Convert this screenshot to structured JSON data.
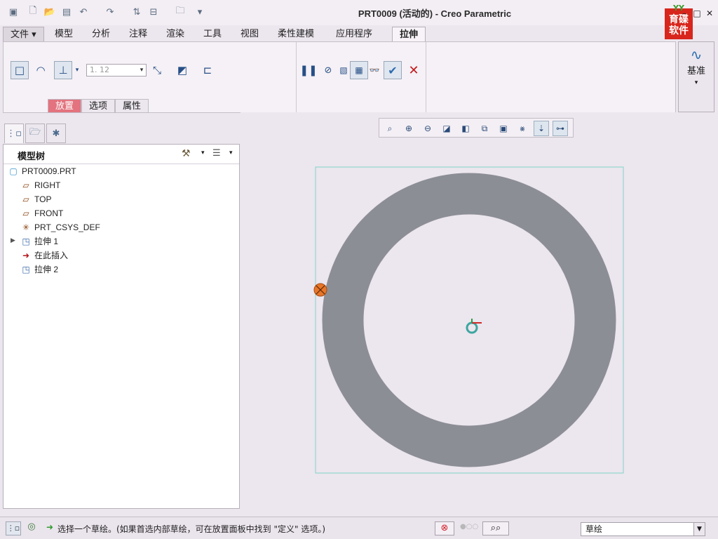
{
  "window": {
    "title": "PRT0009 (活动的) - Creo Parametric",
    "logo_text": "育碟软件",
    "logo_top": "YY"
  },
  "tabs": [
    {
      "label": "文件 ▾"
    },
    {
      "label": "模型"
    },
    {
      "label": "分析"
    },
    {
      "label": "注释"
    },
    {
      "label": "渲染"
    },
    {
      "label": "工具"
    },
    {
      "label": "视图"
    },
    {
      "label": "柔性建模"
    },
    {
      "label": "应用程序"
    },
    {
      "label": "拉伸"
    }
  ],
  "ribbon": {
    "depth_value": "1. 12",
    "subtabs": [
      {
        "label": "放置"
      },
      {
        "label": "选项"
      },
      {
        "label": "属性"
      }
    ],
    "datum_label": "基准"
  },
  "model_tree": {
    "title": "模型树",
    "items": [
      {
        "label": "PRT0009.PRT"
      },
      {
        "label": "RIGHT"
      },
      {
        "label": "TOP"
      },
      {
        "label": "FRONT"
      },
      {
        "label": "PRT_CSYS_DEF"
      },
      {
        "label": "拉伸 1"
      },
      {
        "label": "在此插入"
      },
      {
        "label": "拉伸 2"
      }
    ]
  },
  "status": {
    "message": "选择一个草绘。(如果首选内部草绘，可在放置面板中找到 \"定义\" 选项。)",
    "filter_value": "草绘"
  },
  "colors": {
    "ring": "#8c8e96",
    "frame": "#7fd4c8",
    "handle": "#e8762a",
    "subtab_active": "#e3737e"
  }
}
